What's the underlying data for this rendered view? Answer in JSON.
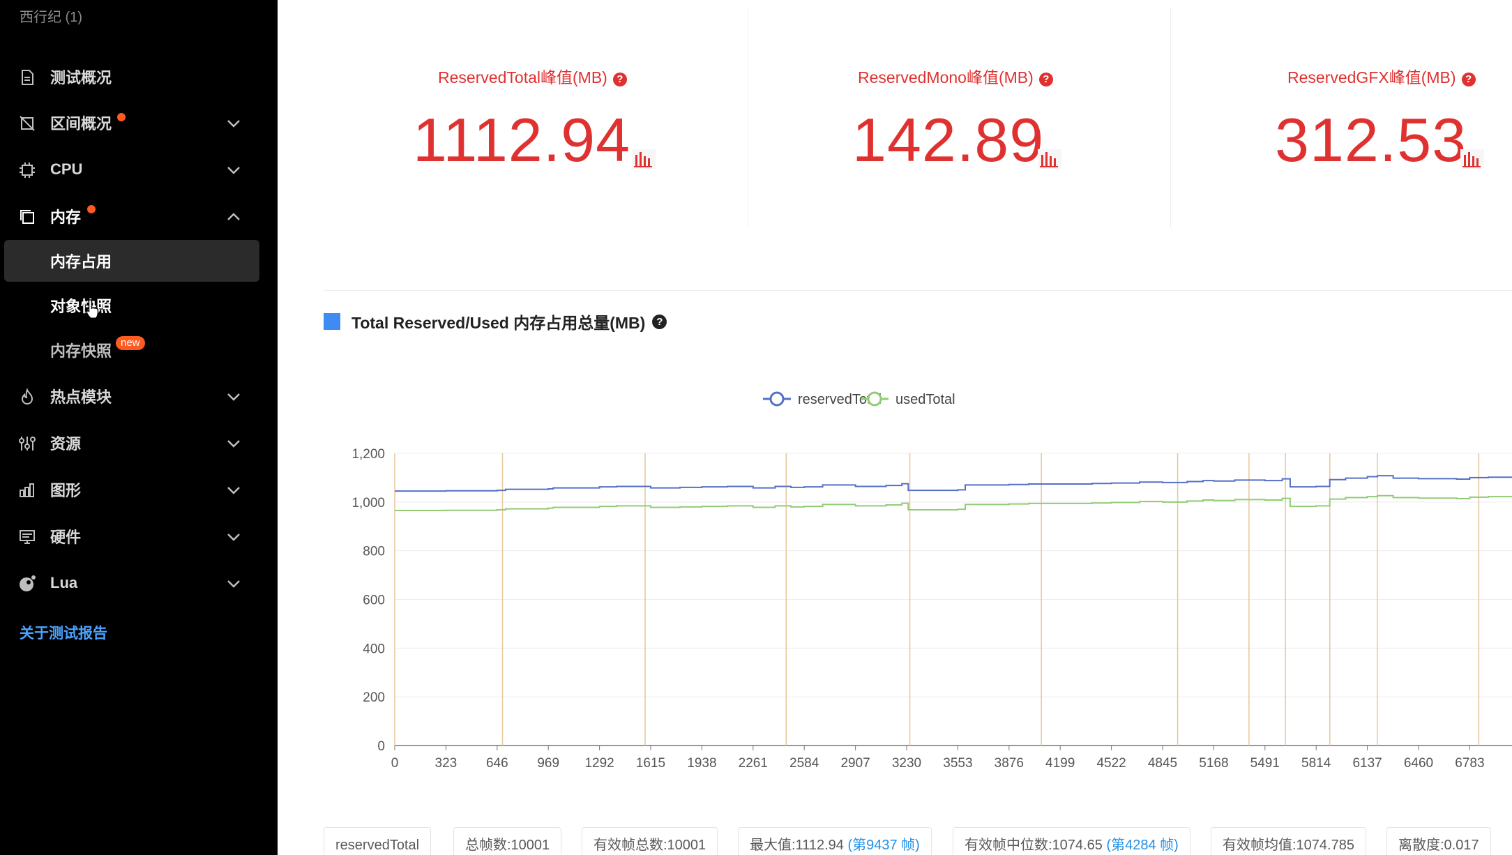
{
  "sidebar": {
    "project_title": "西行纪 (1)",
    "items": [
      {
        "label": "测试概况",
        "icon": "document-icon"
      },
      {
        "label": "区间概况",
        "icon": "range-icon",
        "has_dot": true
      },
      {
        "label": "CPU",
        "icon": "cpu-chip-icon"
      },
      {
        "label": "内存",
        "icon": "memory-copy-icon",
        "has_dot": true,
        "expanded": true
      },
      {
        "label": "热点模块",
        "icon": "flame-icon"
      },
      {
        "label": "资源",
        "icon": "sliders-icon"
      },
      {
        "label": "图形",
        "icon": "bar-chart-icon"
      },
      {
        "label": "硬件",
        "icon": "monitor-icon"
      },
      {
        "label": "Lua",
        "icon": "lua-icon"
      }
    ],
    "memory_sub": [
      {
        "label": "内存占用",
        "selected": true
      },
      {
        "label": "对象快照"
      },
      {
        "label": "内存快照",
        "badge": "new"
      }
    ],
    "about_link": "关于测试报告"
  },
  "main": {
    "stats": [
      {
        "title": "ReservedTotal峰值(MB)",
        "value": "1112.94"
      },
      {
        "title": "ReservedMono峰值(MB)",
        "value": "142.89"
      },
      {
        "title": "ReservedGFX峰值(MB)",
        "value": "312.53"
      }
    ],
    "help_mark": "?",
    "section_title": "Total Reserved/Used 内存占用总量(MB)",
    "summary": {
      "series_label": "reservedTotal",
      "total_frames": "总帧数:10001",
      "valid_frames": "有效帧总数:10001",
      "max_prefix": "最大值:1112.94 ",
      "max_link": "(第9437 帧)",
      "median_prefix": "有效帧中位数:1074.65 ",
      "median_link": "(第4284 帧)",
      "mean": "有效帧均值:1074.785",
      "dispersion": "离散度:0.017"
    }
  },
  "colors": {
    "accent_red": "#e03131",
    "reserved_line": "#5470c6",
    "used_line": "#91cc75",
    "marker_line": "#e9c9a0",
    "link_blue": "#1f8fe5"
  },
  "chart_data": {
    "type": "line",
    "legend": [
      "reservedTotal",
      "usedTotal"
    ],
    "x_ticks": [
      0,
      323,
      646,
      969,
      1292,
      1615,
      1938,
      2261,
      2584,
      2907,
      3230,
      3553,
      3876,
      4199,
      4522,
      4845,
      5168,
      5491,
      5814,
      6137,
      6460,
      6783
    ],
    "ylim": [
      0,
      1200
    ],
    "y_ticks": [
      0,
      200,
      400,
      600,
      800,
      1000,
      1200
    ],
    "marker_frames": [
      0,
      680,
      1580,
      2470,
      3250,
      4080,
      4940,
      5390,
      5620,
      5900,
      6200,
      6840
    ],
    "series": [
      {
        "name": "reservedTotal",
        "x": [
          0,
          323,
          646,
          700,
          969,
          1000,
          1292,
          1400,
          1615,
          1800,
          1938,
          2100,
          2261,
          2400,
          2500,
          2584,
          2700,
          2907,
          3100,
          3200,
          3240,
          3553,
          3600,
          3876,
          4000,
          4199,
          4400,
          4522,
          4700,
          4845,
          5000,
          5100,
          5168,
          5300,
          5491,
          5600,
          5650,
          5814,
          5900,
          6000,
          6137,
          6200,
          6300,
          6460,
          6700,
          6783,
          6900
        ],
        "values": [
          1045,
          1046,
          1048,
          1052,
          1054,
          1058,
          1062,
          1064,
          1058,
          1060,
          1062,
          1064,
          1058,
          1064,
          1060,
          1062,
          1070,
          1064,
          1068,
          1075,
          1048,
          1050,
          1070,
          1072,
          1074,
          1074,
          1076,
          1078,
          1082,
          1080,
          1084,
          1088,
          1086,
          1090,
          1088,
          1095,
          1062,
          1064,
          1092,
          1098,
          1104,
          1108,
          1098,
          1096,
          1094,
          1100,
          1102
        ]
      },
      {
        "name": "usedTotal",
        "x": [
          0,
          323,
          646,
          700,
          969,
          1000,
          1292,
          1400,
          1615,
          1800,
          1938,
          2100,
          2261,
          2400,
          2500,
          2584,
          2700,
          2907,
          3100,
          3200,
          3240,
          3553,
          3600,
          3876,
          4000,
          4199,
          4400,
          4522,
          4700,
          4845,
          5000,
          5100,
          5168,
          5300,
          5491,
          5600,
          5650,
          5814,
          5900,
          6000,
          6137,
          6200,
          6300,
          6460,
          6700,
          6783,
          6900
        ],
        "values": [
          965,
          966,
          968,
          972,
          975,
          978,
          982,
          984,
          978,
          980,
          982,
          984,
          978,
          984,
          980,
          982,
          990,
          984,
          988,
          995,
          968,
          970,
          990,
          992,
          994,
          994,
          996,
          998,
          1002,
          1000,
          1004,
          1008,
          1006,
          1010,
          1008,
          1015,
          982,
          984,
          1012,
          1018,
          1022,
          1026,
          1018,
          1016,
          1014,
          1020,
          1022
        ]
      }
    ]
  }
}
